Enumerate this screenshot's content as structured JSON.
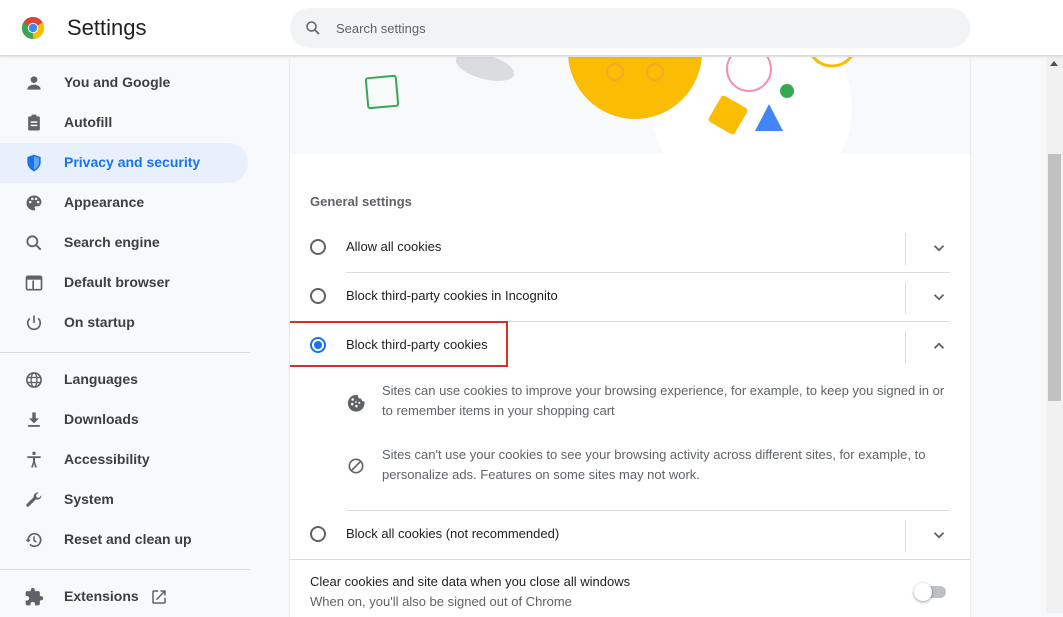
{
  "header": {
    "title": "Settings",
    "logo_icon": "chrome-logo-icon",
    "search_placeholder": "Search settings"
  },
  "sidebar": {
    "active_index": 2,
    "items": [
      {
        "label": "You and Google",
        "icon": "person-icon"
      },
      {
        "label": "Autofill",
        "icon": "clipboard-icon"
      },
      {
        "label": "Privacy and security",
        "icon": "shield-icon"
      },
      {
        "label": "Appearance",
        "icon": "palette-icon"
      },
      {
        "label": "Search engine",
        "icon": "search-icon"
      },
      {
        "label": "Default browser",
        "icon": "browser-window-icon"
      },
      {
        "label": "On startup",
        "icon": "power-icon"
      },
      {
        "label": "Languages",
        "icon": "globe-icon"
      },
      {
        "label": "Downloads",
        "icon": "download-icon"
      },
      {
        "label": "Accessibility",
        "icon": "accessibility-icon"
      },
      {
        "label": "System",
        "icon": "wrench-icon"
      },
      {
        "label": "Reset and clean up",
        "icon": "history-icon"
      },
      {
        "label": "Extensions",
        "icon": "puzzle-icon"
      }
    ],
    "extensions_external_icon": "open-in-new-icon"
  },
  "main": {
    "section_title": "General settings",
    "options": [
      {
        "label": "Allow all cookies",
        "selected": false,
        "expanded": false
      },
      {
        "label": "Block third-party cookies in Incognito",
        "selected": false,
        "expanded": false
      },
      {
        "label": "Block third-party cookies",
        "selected": true,
        "expanded": true
      },
      {
        "label": "Block all cookies (not recommended)",
        "selected": false,
        "expanded": false
      }
    ],
    "details": [
      {
        "icon": "cookie-icon",
        "text": "Sites can use cookies to improve your browsing experience, for example, to keep you signed in or to remember items in your shopping cart"
      },
      {
        "icon": "block-icon",
        "text": "Sites can't use your cookies to see your browsing activity across different sites, for example, to personalize ads. Features on some sites may not work."
      }
    ],
    "clear_on_exit": {
      "title": "Clear cookies and site data when you close all windows",
      "subtitle": "When on, you'll also be signed out of Chrome",
      "enabled": false
    }
  },
  "colors": {
    "accent": "#1a73e8",
    "active_bg": "#e8f0fe",
    "highlight_border": "#d93025",
    "banner_yellow": "#fbbc04",
    "banner_green": "#34a853"
  }
}
